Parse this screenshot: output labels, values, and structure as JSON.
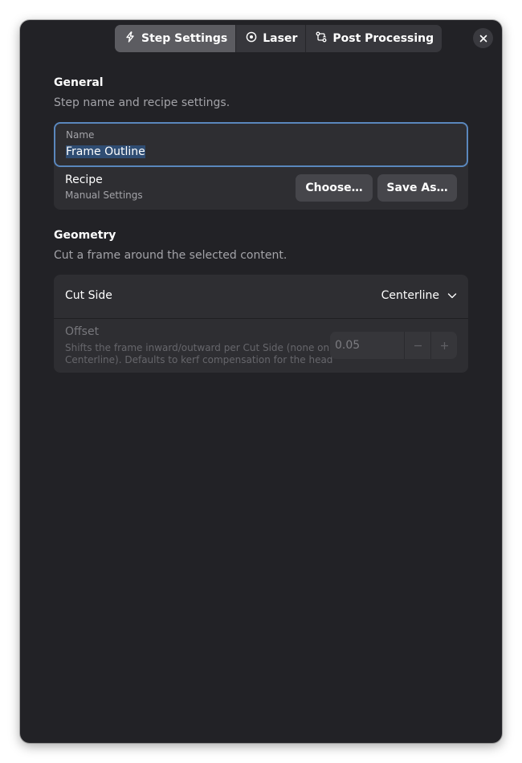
{
  "tabs": [
    {
      "label": "Step Settings",
      "icon": "lightning-icon",
      "active": true
    },
    {
      "label": "Laser",
      "icon": "target-icon",
      "active": false
    },
    {
      "label": "Post Processing",
      "icon": "workflow-icon",
      "active": false
    }
  ],
  "general": {
    "title": "General",
    "description": "Step name and recipe settings.",
    "name_label": "Name",
    "name_value": "Frame Outline",
    "recipe_title": "Recipe",
    "recipe_subtitle": "Manual Settings",
    "choose_button": "Choose…",
    "save_as_button": "Save As…"
  },
  "geometry": {
    "title": "Geometry",
    "description": "Cut a frame around the selected content.",
    "cut_side_label": "Cut Side",
    "cut_side_value": "Centerline",
    "offset_title": "Offset",
    "offset_desc_line1": "Shifts the frame inward/outward per Cut Side (none on",
    "offset_desc_line2": "Centerline). Defaults to kerf compensation for the head",
    "offset_value": "0.05"
  },
  "colors": {
    "window_bg": "#222226",
    "card_bg": "#2e2e32",
    "focus_border": "#5a87bd",
    "selection": "#2f4d73"
  }
}
